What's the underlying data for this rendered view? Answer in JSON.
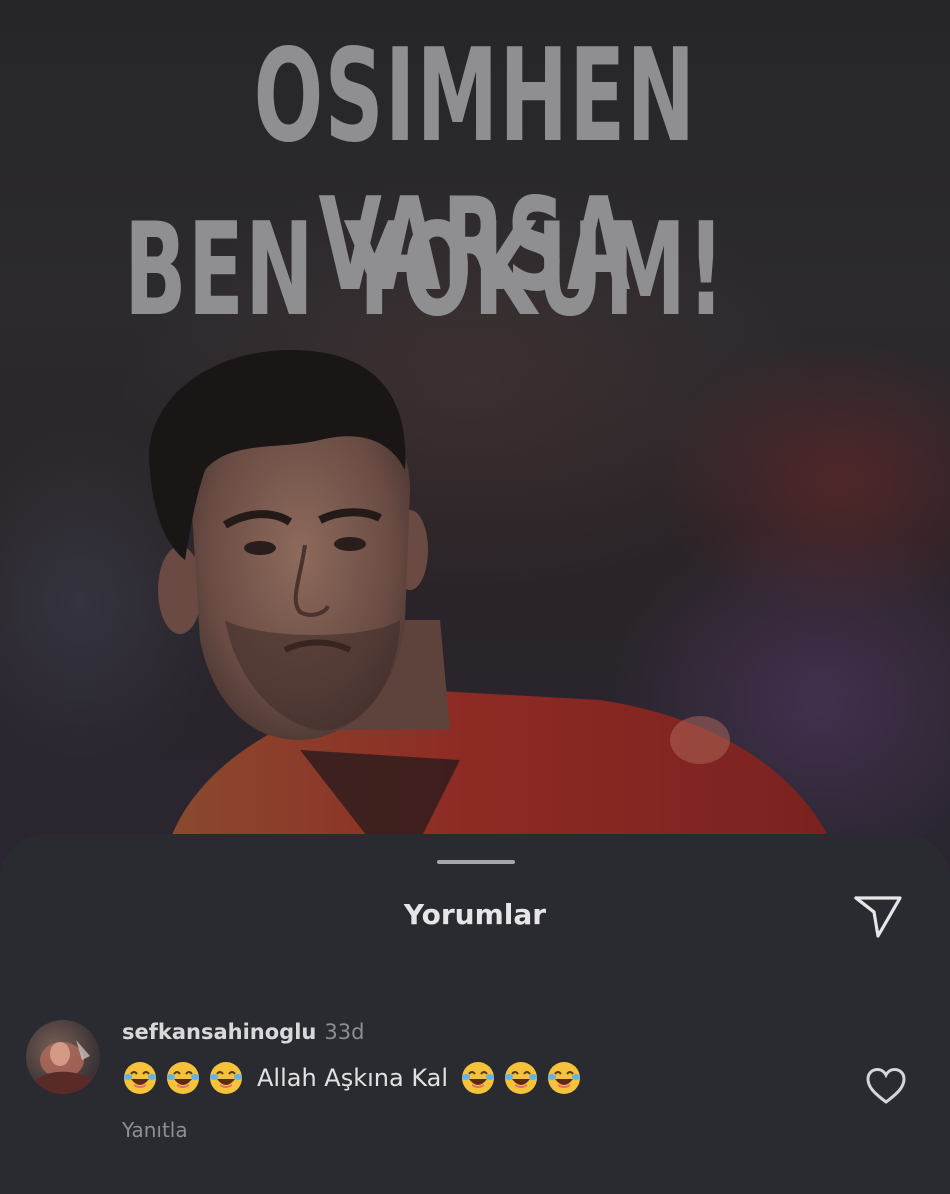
{
  "post": {
    "headline_line1": "OSIMHEN VARSA",
    "headline_line2": "BEN YOKUM!"
  },
  "comments_sheet": {
    "title": "Yorumlar",
    "comments": [
      {
        "username": "sefkansahinoglu",
        "time": "33d",
        "emoji_before": [
          "laughing-emoji",
          "laughing-emoji",
          "laughing-emoji"
        ],
        "text": "Allah Aşkına Kal",
        "emoji_after": [
          "laughing-emoji",
          "laughing-emoji",
          "laughing-emoji"
        ],
        "reply_label": "Yanıtla"
      }
    ]
  },
  "icons": {
    "share": "paper-plane-icon",
    "like": "heart-icon",
    "emoji": "face-with-tears-of-joy-emoji"
  },
  "colors": {
    "sheet_background": "#2a2b30",
    "headline": "#8f8f92",
    "jersey_red": "#8e2a24"
  }
}
